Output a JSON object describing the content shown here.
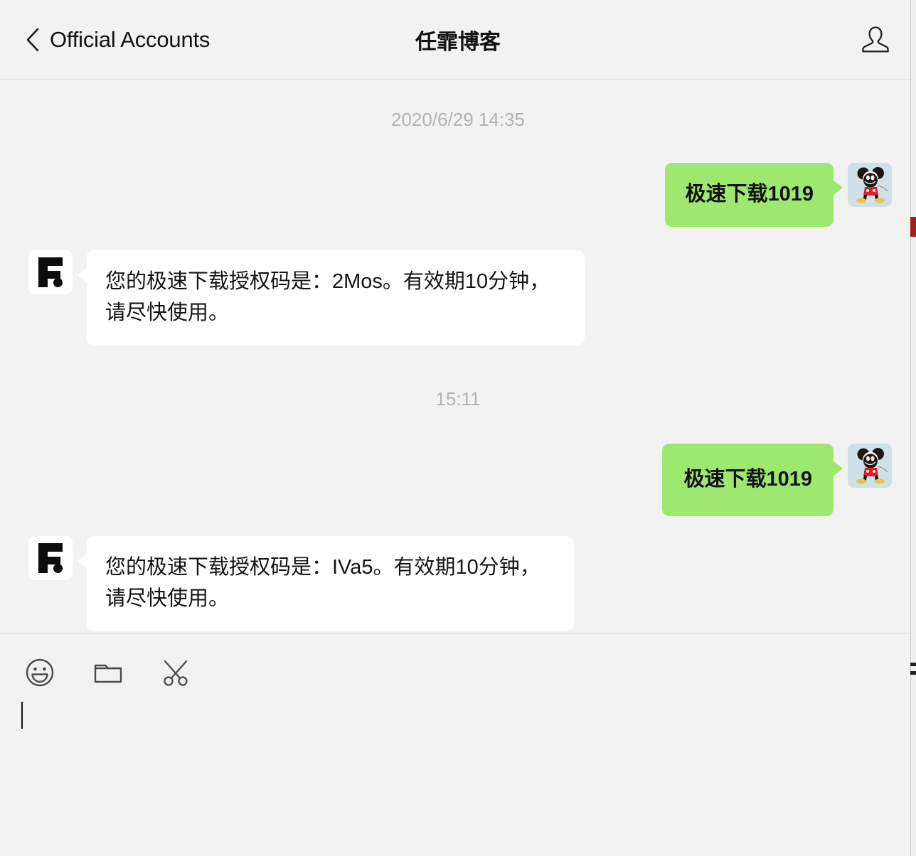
{
  "header": {
    "back_label": "Official Accounts",
    "title": "任霏博客",
    "back_icon": "chevron-left-icon",
    "contact_icon": "contact-person-icon"
  },
  "conversation": {
    "entries": [
      {
        "kind": "timestamp",
        "text": "2020/6/29 14:35"
      },
      {
        "kind": "message",
        "direction": "outgoing",
        "text": "极速下载1019",
        "avatar": "mickey-mouse-avatar"
      },
      {
        "kind": "message",
        "direction": "incoming",
        "text": "您的极速下载授权码是：2Mos。有效期10分钟，请尽快使用。",
        "avatar": "f-brand-logo-avatar"
      },
      {
        "kind": "timestamp",
        "text": "15:11"
      },
      {
        "kind": "message",
        "direction": "outgoing",
        "text": "极速下载1019",
        "avatar": "mickey-mouse-avatar"
      },
      {
        "kind": "message",
        "direction": "incoming",
        "text": "您的极速下载授权码是：IVa5。有效期10分钟，请尽快使用。",
        "avatar": "f-brand-logo-avatar"
      }
    ]
  },
  "composer": {
    "tools": [
      {
        "icon": "emoji-smiley-icon",
        "label": "Emoji"
      },
      {
        "icon": "folder-icon",
        "label": "Send File"
      },
      {
        "icon": "scissors-icon",
        "label": "Screenshot"
      }
    ],
    "input_value": "",
    "input_placeholder": ""
  },
  "colors": {
    "outgoing_bubble": "#9fe870",
    "incoming_bubble": "#ffffff",
    "page_background": "#f2f2f2",
    "timestamp_text": "#b3b3b3",
    "accent_red": "#9b2222"
  }
}
